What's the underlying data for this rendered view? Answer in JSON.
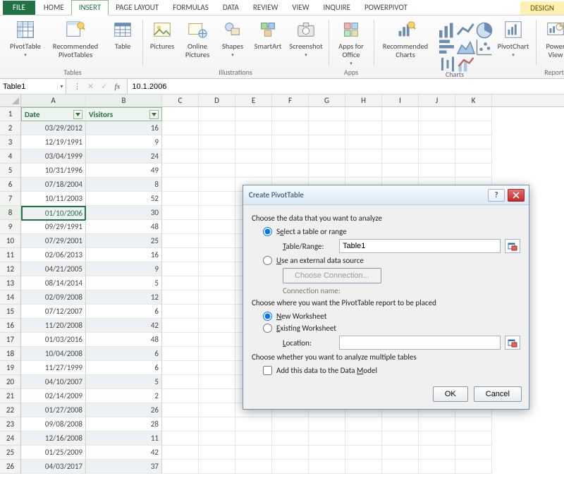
{
  "tabs": {
    "file": "FILE",
    "items": [
      "HOME",
      "INSERT",
      "PAGE LAYOUT",
      "FORMULAS",
      "DATA",
      "REVIEW",
      "VIEW",
      "INQUIRE",
      "POWERPIVOT"
    ],
    "active_index": 1,
    "context": "DESIGN"
  },
  "ribbon": {
    "groups": {
      "tables": {
        "label": "Tables",
        "pivottable": "PivotTable",
        "recommended": "Recommended PivotTables",
        "table": "Table"
      },
      "illustrations": {
        "label": "Illustrations",
        "pictures": "Pictures",
        "online": "Online Pictures",
        "shapes": "Shapes",
        "smartart": "SmartArt",
        "screenshot": "Screenshot"
      },
      "apps": {
        "label": "Apps",
        "apps_for_office": "Apps for Office"
      },
      "charts": {
        "label": "Charts",
        "recommended": "Recommended Charts",
        "pivotchart": "PivotChart"
      },
      "reports": {
        "label": "Reports",
        "powerview": "Power View"
      }
    }
  },
  "namebox": {
    "value": "Table1"
  },
  "formula_bar": {
    "fx": "fx",
    "value": "10.1.2006"
  },
  "sheet": {
    "columns": [
      "A",
      "B",
      "C",
      "D",
      "E",
      "F",
      "G",
      "H",
      "I",
      "J",
      "K"
    ],
    "header_row_index": 1,
    "headers": {
      "col1": "Date",
      "col2": "Visitors"
    },
    "active_cell_row": 8,
    "rows": [
      {
        "n": 2,
        "date": "03/29/2012",
        "v": "16"
      },
      {
        "n": 3,
        "date": "12/19/1991",
        "v": "9"
      },
      {
        "n": 4,
        "date": "03/04/1999",
        "v": "24"
      },
      {
        "n": 5,
        "date": "10/31/1996",
        "v": "49"
      },
      {
        "n": 6,
        "date": "07/18/2004",
        "v": "8"
      },
      {
        "n": 7,
        "date": "10/11/2003",
        "v": "52"
      },
      {
        "n": 8,
        "date": "01/10/2006",
        "v": "30"
      },
      {
        "n": 9,
        "date": "09/29/1991",
        "v": "48"
      },
      {
        "n": 10,
        "date": "07/29/2001",
        "v": "25"
      },
      {
        "n": 11,
        "date": "02/06/2013",
        "v": "16"
      },
      {
        "n": 12,
        "date": "04/21/2005",
        "v": "9"
      },
      {
        "n": 13,
        "date": "08/14/2014",
        "v": "5"
      },
      {
        "n": 14,
        "date": "02/09/2008",
        "v": "12"
      },
      {
        "n": 15,
        "date": "07/12/2007",
        "v": "6"
      },
      {
        "n": 16,
        "date": "11/20/2008",
        "v": "42"
      },
      {
        "n": 17,
        "date": "01/03/2016",
        "v": "48"
      },
      {
        "n": 18,
        "date": "10/04/2008",
        "v": "6"
      },
      {
        "n": 19,
        "date": "11/27/1999",
        "v": "6"
      },
      {
        "n": 20,
        "date": "04/10/2007",
        "v": "5"
      },
      {
        "n": 21,
        "date": "02/14/2009",
        "v": "2"
      },
      {
        "n": 22,
        "date": "01/27/2008",
        "v": "26"
      },
      {
        "n": 23,
        "date": "09/08/2008",
        "v": "28"
      },
      {
        "n": 24,
        "date": "12/16/2008",
        "v": "11"
      },
      {
        "n": 25,
        "date": "01/25/2009",
        "v": "42"
      },
      {
        "n": 26,
        "date": "04/03/2017",
        "v": "37"
      }
    ]
  },
  "dialog": {
    "title": "Create PivotTable",
    "section1": "Choose the data that you want to analyze",
    "opt_select_range_pre": "S",
    "opt_select_range_key": "e",
    "opt_select_range_post": "lect a table or range",
    "tr_label_key": "T",
    "tr_label_post": "able/Range:",
    "tr_value": "Table1",
    "opt_external_key": "U",
    "opt_external_post": "se an external data source",
    "choose_conn": "Choose Connection...",
    "conn_name_label": "Connection name:",
    "section2": "Choose where you want the PivotTable report to be placed",
    "opt_new_key": "N",
    "opt_new_post": "ew Worksheet",
    "opt_existing_key": "E",
    "opt_existing_post": "xisting Worksheet",
    "loc_label_key": "L",
    "loc_label_post": "ocation:",
    "loc_value": "",
    "section3": "Choose whether you want to analyze multiple tables",
    "chk_model_pre": "Add this data to the Data ",
    "chk_model_key": "M",
    "chk_model_post": "odel",
    "ok": "OK",
    "cancel": "Cancel"
  }
}
